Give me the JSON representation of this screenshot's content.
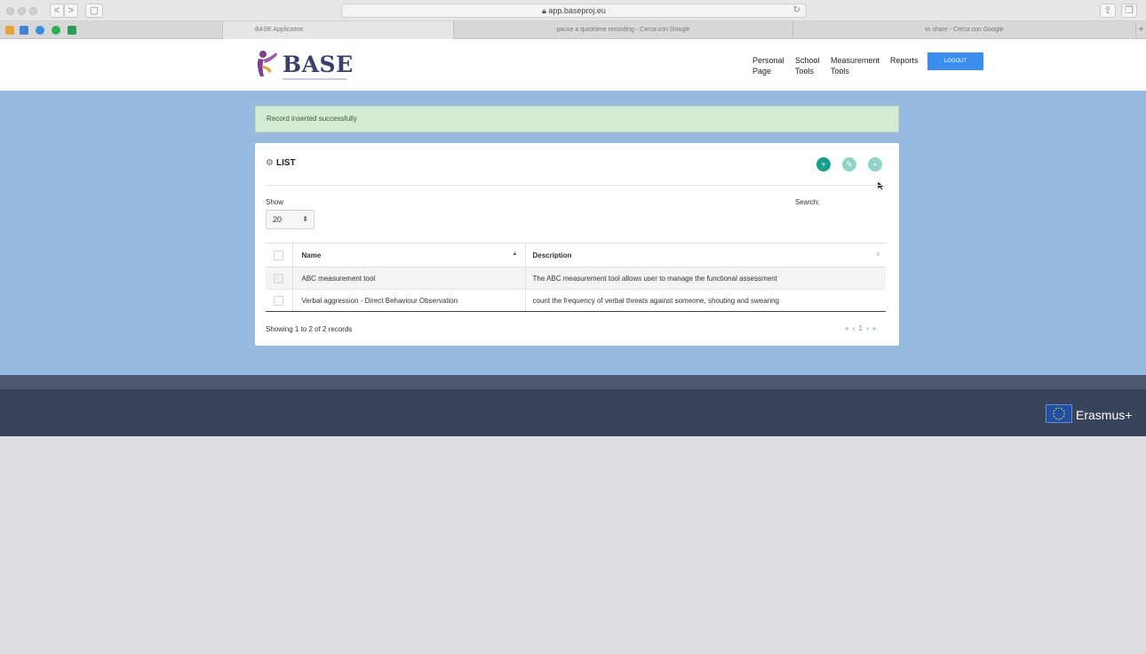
{
  "browser": {
    "url": "app.baseproj.eu",
    "nav_back": "<",
    "nav_forward": ">",
    "tabs": [
      {
        "label": "BASE Application"
      },
      {
        "label": "pause a quicktime recording - Cerca con Google"
      },
      {
        "label": "to share - Cerca con Google"
      }
    ],
    "new_tab": "+"
  },
  "header": {
    "brand": "BASE",
    "nav": [
      {
        "line1": "Personal",
        "line2": "Page"
      },
      {
        "line1": "School",
        "line2": "Tools"
      },
      {
        "line1": "Measurement",
        "line2": "Tools"
      },
      {
        "line1": "Reports",
        "line2": ""
      }
    ],
    "logout_label": "LOGOUT"
  },
  "alert": {
    "message": "Record inserted successfully"
  },
  "list": {
    "title": "LIST",
    "actions": [
      {
        "name": "add",
        "icon": "plus-icon",
        "color": "#169e8f"
      },
      {
        "name": "edit",
        "icon": "pencil-icon",
        "color": "#8fd3c9"
      },
      {
        "name": "delete",
        "icon": "trash-icon",
        "color": "#8fd3c9"
      }
    ],
    "show_label": "Show",
    "page_size": "20",
    "search_label": "Search:",
    "columns": {
      "name": "Name",
      "description": "Description"
    },
    "rows": [
      {
        "name": "ABC measurement tool",
        "description": "The ABC measurement tool allows user to manage the functional assessment"
      },
      {
        "name": "Verbal aggression - Direct Behaviour Observation",
        "description": "count the frequency of verbal threats against someone, shouting and swearing"
      }
    ],
    "info": "Showing 1 to 2 of 2 records",
    "pager": "« ‹ 1 › »"
  },
  "footer": {
    "program": "Erasmus+"
  },
  "colors": {
    "accent": "#3c8df0",
    "band": "#97bbe0",
    "footer": "#394359",
    "success_bg": "#d3ead3"
  }
}
